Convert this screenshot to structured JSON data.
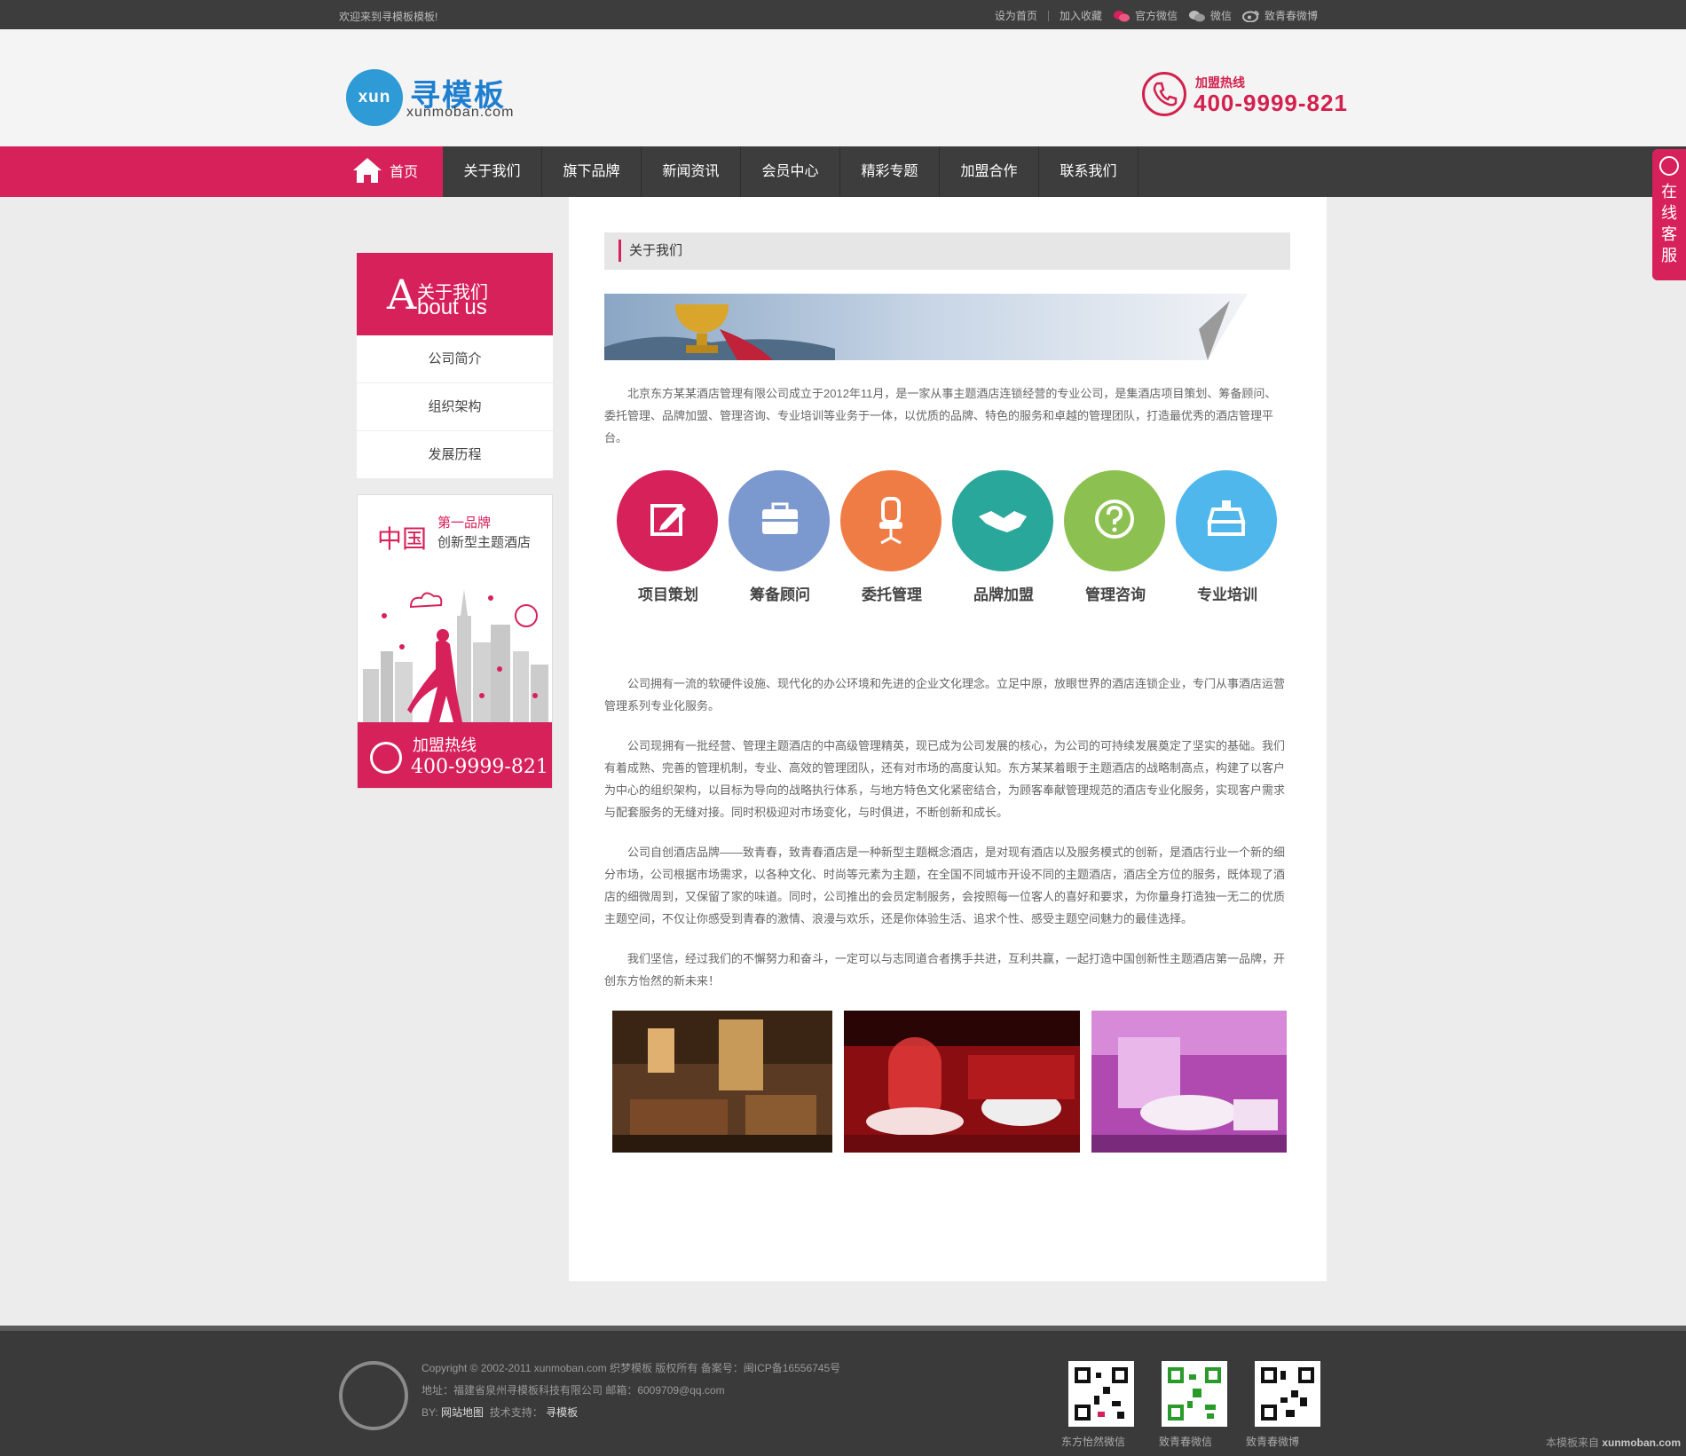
{
  "topbar": {
    "welcome": "欢迎来到寻模板模板!",
    "links": [
      "设为首页",
      "加入收藏",
      "官方微信",
      "微信",
      "致青春微博"
    ]
  },
  "logo": {
    "badge": "xun",
    "name": "寻模板",
    "domain": "xunmoban.com"
  },
  "hotline": {
    "label": "加盟热线",
    "number": "400-9999-821"
  },
  "nav": {
    "home": "首页",
    "items": [
      "关于我们",
      "旗下品牌",
      "新闻资讯",
      "会员中心",
      "精彩专题",
      "加盟合作",
      "联系我们"
    ]
  },
  "side_tab": {
    "label": "在线客服"
  },
  "sidebar": {
    "letter": "A",
    "title_cn": "关于我们",
    "title_en": "bout us",
    "items": [
      "公司简介",
      "组织架构",
      "发展历程"
    ]
  },
  "ad": {
    "country": "中国",
    "rank": "第一品牌",
    "slogan": "创新型主题酒店",
    "hotline_label": "加盟热线",
    "hotline_number": "400-9999-821"
  },
  "crumb": {
    "title": "关于我们"
  },
  "paragraphs": {
    "p1": "北京东方某某酒店管理有限公司成立于2012年11月，是一家从事主题酒店连锁经营的专业公司，是集酒店项目策划、筹备顾问、委托管理、品牌加盟、管理咨询、专业培训等业务于一体，以优质的品牌、特色的服务和卓越的管理团队，打造最优秀的酒店管理平台。",
    "p2": "公司拥有一流的软硬件设施、现代化的办公环境和先进的企业文化理念。立足中原，放眼世界的酒店连锁企业，专门从事酒店运营管理系列专业化服务。",
    "p3": "公司现拥有一批经营、管理主题酒店的中高级管理精英，现已成为公司发展的核心，为公司的可持续发展奠定了坚实的基础。我们有着成熟、完善的管理机制，专业、高效的管理团队，还有对市场的高度认知。东方某某着眼于主题酒店的战略制高点，构建了以客户为中心的组织架构，以目标为导向的战略执行体系，与地方特色文化紧密结合，为顾客奉献管理规范的酒店专业化服务，实现客户需求与配套服务的无缝对接。同时积极迎对市场变化，与时俱进，不断创新和成长。",
    "p4": "公司自创酒店品牌——致青春，致青春酒店是一种新型主题概念酒店，是对现有酒店以及服务模式的创新，是酒店行业一个新的细分市场，公司根据市场需求，以各种文化、时尚等元素为主题，在全国不同城市开设不同的主题酒店，酒店全方位的服务，既体现了酒店的细微周到，又保留了家的味道。同时，公司推出的会员定制服务，会按照每一位客人的喜好和要求，为你量身打造独一无二的优质主题空间，不仅让你感受到青春的激情、浪漫与欢乐，还是你体验生活、追求个性、感受主题空间魅力的最佳选择。",
    "p5": "我们坚信，经过我们的不懈努力和奋斗，一定可以与志同道合者携手共进，互利共赢，一起打造中国创新性主题酒店第一品牌，开创东方怡然的新未来！"
  },
  "services": [
    {
      "label": "项目策划",
      "color": "#d7215b",
      "icon": "edit-icon"
    },
    {
      "label": "筹备顾问",
      "color": "#7b98cf",
      "icon": "briefcase-icon"
    },
    {
      "label": "委托管理",
      "color": "#f07c45",
      "icon": "chair-icon"
    },
    {
      "label": "品牌加盟",
      "color": "#2aa79b",
      "icon": "handshake-icon"
    },
    {
      "label": "管理咨询",
      "color": "#8cc152",
      "icon": "question-icon"
    },
    {
      "label": "专业培训",
      "color": "#4fb7ec",
      "icon": "training-icon"
    }
  ],
  "footer": {
    "copyright": "Copyright © 2002-2011 xunmoban.com 织梦模板 版权所有 备案号：闽ICP备16556745号",
    "address": "地址：福建省泉州寻模板科技有限公司 邮箱：6009709@qq.com",
    "by_prefix": "BY:",
    "sitemap": "网站地图",
    "support_prefix": "技术支持：",
    "support": "寻模板",
    "qr_labels": [
      "东方怡然微信",
      "致青春微信",
      "致青春微博"
    ]
  },
  "watermark": {
    "prefix": "本模板来自",
    "site": "xunmoban.com"
  },
  "colors": {
    "accent": "#d7215b",
    "dark": "#3d3d3d",
    "brand_blue": "#2e9ad6"
  }
}
